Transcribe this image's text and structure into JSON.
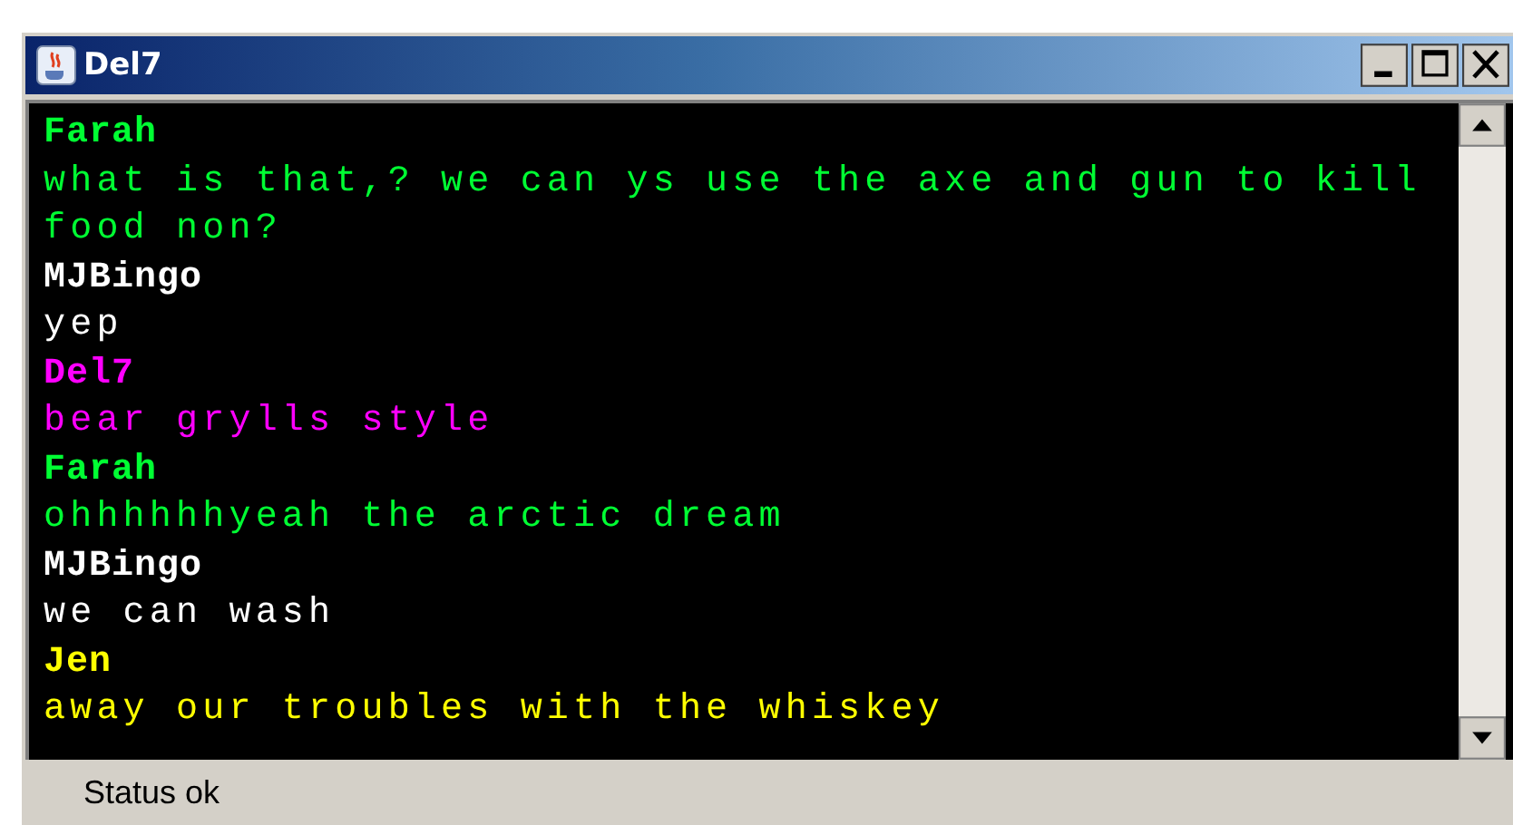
{
  "window": {
    "title": "Del7"
  },
  "messages": [
    {
      "sender": "Farah",
      "color": "#00ff33",
      "lines": [
        "what is that,? we can ys use the axe and gun to kill",
        "food non?"
      ]
    },
    {
      "sender": "MJBingo",
      "color": "#ffffff",
      "lines": [
        "yep"
      ]
    },
    {
      "sender": "Del7",
      "color": "#ff00ff",
      "lines": [
        "bear grylls style"
      ]
    },
    {
      "sender": "Farah",
      "color": "#00ff33",
      "lines": [
        "ohhhhhhyeah the arctic dream"
      ]
    },
    {
      "sender": "MJBingo",
      "color": "#ffffff",
      "lines": [
        "we can wash"
      ]
    },
    {
      "sender": "Jen",
      "color": "#ffff00",
      "lines": [
        "away our troubles with the whiskey"
      ]
    }
  ],
  "status_bar": "Status ok"
}
